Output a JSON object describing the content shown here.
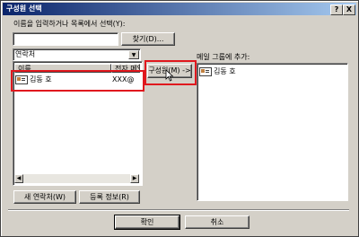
{
  "window": {
    "title": "구성원 선택",
    "help_label": "?",
    "close_label": "X"
  },
  "search": {
    "prompt": "이름을 입력하거나 목록에서 선택(Y):",
    "value": "",
    "find_button": "찾기(D)..."
  },
  "address_book": {
    "selected": "연락처"
  },
  "left_list": {
    "columns": [
      "이름",
      "전자 메일"
    ],
    "rows": [
      {
        "name": "김동 호",
        "email": "XXX@"
      }
    ]
  },
  "member_button": "구성원(M) ->",
  "right_list": {
    "header": "메일 그룹에 추가:",
    "rows": [
      {
        "name": "김동 호"
      }
    ]
  },
  "bottom_buttons": {
    "new_contact": "새 연락처(W)",
    "properties": "등록 정보(R)",
    "ok": "확인",
    "cancel": "취소"
  },
  "icons": {
    "contact_card": "contact-card-icon",
    "cursor": "mouse-cursor-icon"
  },
  "colors": {
    "highlight": "#e0181e",
    "titlebar": "#0a246a"
  }
}
